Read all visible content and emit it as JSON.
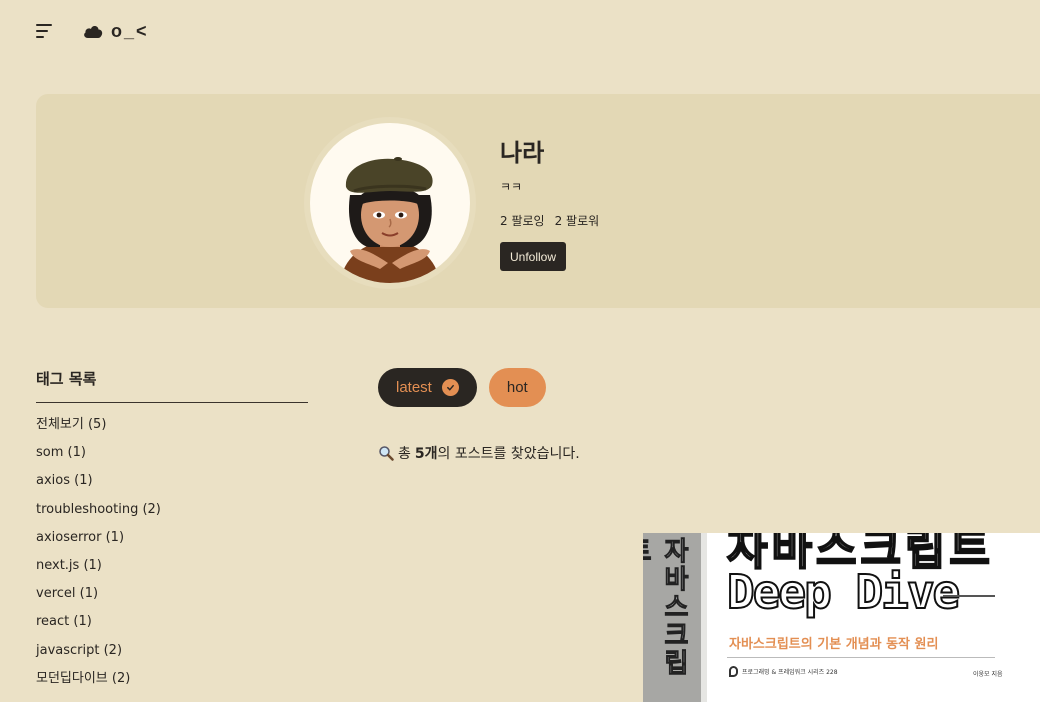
{
  "header": {
    "logo_text": "o_<",
    "icons": [
      "menu-icon",
      "cloud-icon"
    ]
  },
  "profile": {
    "name": "나라",
    "bio": "ㅋㅋ",
    "following": "2 팔로잉",
    "followers": "2 팔로워",
    "unfollow_label": "Unfollow"
  },
  "sidebar": {
    "title": "태그 목록",
    "tags": [
      {
        "label": "전체보기 (5)"
      },
      {
        "label": "som (1)"
      },
      {
        "label": "axios (1)"
      },
      {
        "label": "troubleshooting (2)"
      },
      {
        "label": "axioserror (1)"
      },
      {
        "label": "next.js (1)"
      },
      {
        "label": "vercel (1)"
      },
      {
        "label": "react (1)"
      },
      {
        "label": "javascript (2)"
      },
      {
        "label": "모던딥다이브 (2)"
      }
    ]
  },
  "filters": {
    "latest_label": "latest",
    "hot_label": "hot",
    "active": "latest"
  },
  "result": {
    "prefix": "총",
    "count": "5개",
    "suffix": "의 포스트를 찾았습니다."
  },
  "book": {
    "spine_text": "자바스크립트",
    "title_top": "자바스크립트",
    "title": "Deep Dive",
    "subtitle": "자바스크립트의 기본 개념과 동작 원리",
    "publisher": "프로그래밍 & 프레임워크 시리즈 228",
    "author": "이웅모 지음"
  },
  "colors": {
    "background": "#ebe1c6",
    "card": "#e3d8b5",
    "dark": "#2a2622",
    "accent": "#e38f53"
  }
}
